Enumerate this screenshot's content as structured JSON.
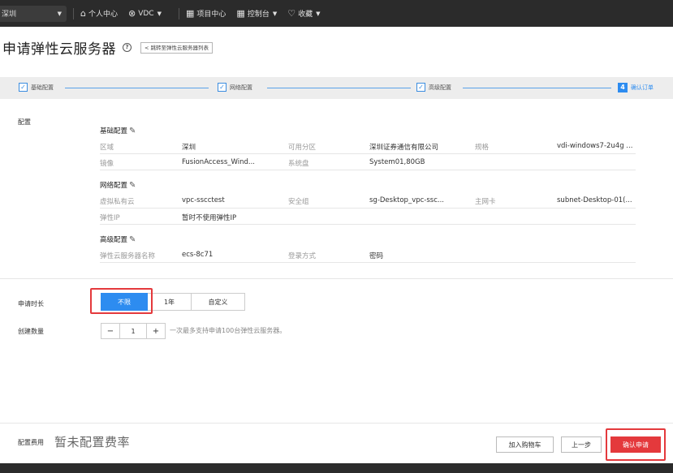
{
  "topbar": {
    "region": "深圳",
    "nav": [
      {
        "icon": "home-icon",
        "label": "个人中心",
        "has_caret": false
      },
      {
        "icon": "vdc-icon",
        "label": "VDC",
        "has_caret": true
      },
      {
        "icon": "grid-icon",
        "label": "项目中心",
        "has_caret": false
      },
      {
        "icon": "grid-icon",
        "label": "控制台",
        "has_caret": true
      },
      {
        "icon": "heart-icon",
        "label": "收藏",
        "has_caret": true
      }
    ]
  },
  "page": {
    "title": "申请弹性云服务器",
    "back_link": "< 跳转至弹性云服务器列表"
  },
  "steps": [
    {
      "label": "基础配置",
      "state": "done"
    },
    {
      "label": "网络配置",
      "state": "done"
    },
    {
      "label": "高级配置",
      "state": "done"
    },
    {
      "label": "确认订单",
      "state": "active",
      "number": "4"
    }
  ],
  "config": {
    "label": "配置",
    "basic": {
      "title": "基础配置",
      "rows": [
        [
          {
            "k": "区域",
            "v": "深圳"
          },
          {
            "k": "可用分区",
            "v": "深圳证券通信有限公司"
          },
          {
            "k": "规格",
            "v": "vdi-windows7-2u4g ..."
          }
        ],
        [
          {
            "k": "镜像",
            "v": "FusionAccess_Wind..."
          },
          {
            "k": "系统盘",
            "v": "System01,80GB"
          }
        ]
      ]
    },
    "network": {
      "title": "网络配置",
      "rows": [
        [
          {
            "k": "虚拟私有云",
            "v": "vpc-sscctest"
          },
          {
            "k": "安全组",
            "v": "sg-Desktop_vpc-ssc..."
          },
          {
            "k": "主网卡",
            "v": "subnet-Desktop-01(..."
          }
        ],
        [
          {
            "k": "弹性IP",
            "v": "暂时不使用弹性IP"
          }
        ]
      ]
    },
    "advanced": {
      "title": "高级配置",
      "rows": [
        [
          {
            "k": "弹性云服务器名称",
            "v": "ecs-8c71"
          },
          {
            "k": "登录方式",
            "v": "密码"
          }
        ]
      ]
    }
  },
  "form": {
    "duration_label": "申请时长",
    "duration_options": [
      "不限",
      "1年",
      "自定义"
    ],
    "duration_selected": "不限",
    "quantity_label": "创建数量",
    "quantity_value": "1",
    "quantity_hint": "一次最多支持申请100台弹性云服务器。"
  },
  "footer": {
    "fee_label": "配置费用",
    "fee_value": "暂未配置费率",
    "add_cart": "加入购物车",
    "prev": "上一步",
    "confirm": "确认申请"
  },
  "colors": {
    "accent": "#2d8cf0",
    "danger": "#e4393c",
    "topbar": "#2b2b2b"
  }
}
